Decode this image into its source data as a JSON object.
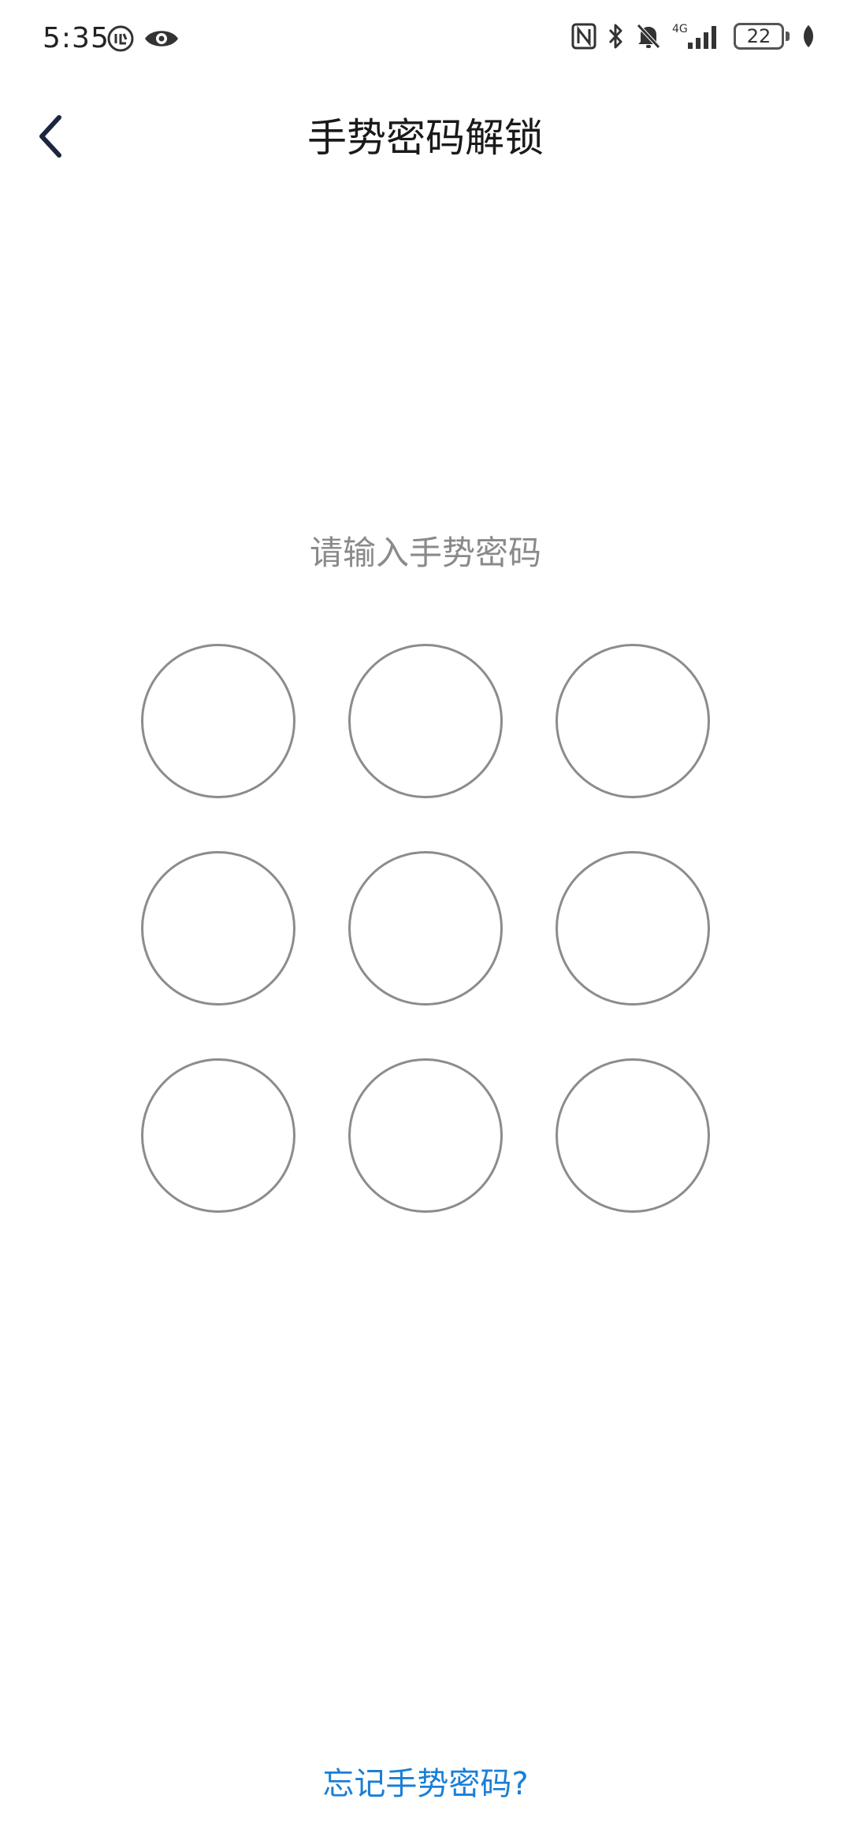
{
  "status_bar": {
    "time": "5:35",
    "left_icons": [
      "notification-badge-icon",
      "eye-icon"
    ],
    "right_icons": [
      "nfc-icon",
      "bluetooth-icon",
      "mute-icon",
      "signal-4g-icon"
    ],
    "network_label": "4G",
    "battery_level": "22"
  },
  "header": {
    "title": "手势密码解锁",
    "back_icon": "chevron-left-icon"
  },
  "prompt": {
    "text": "请输入手势密码"
  },
  "pattern": {
    "rows": 3,
    "cols": 3,
    "dot_color": "#8c8c8c"
  },
  "footer": {
    "forgot_label": "忘记手势密码?",
    "link_color": "#1a7fd6"
  }
}
